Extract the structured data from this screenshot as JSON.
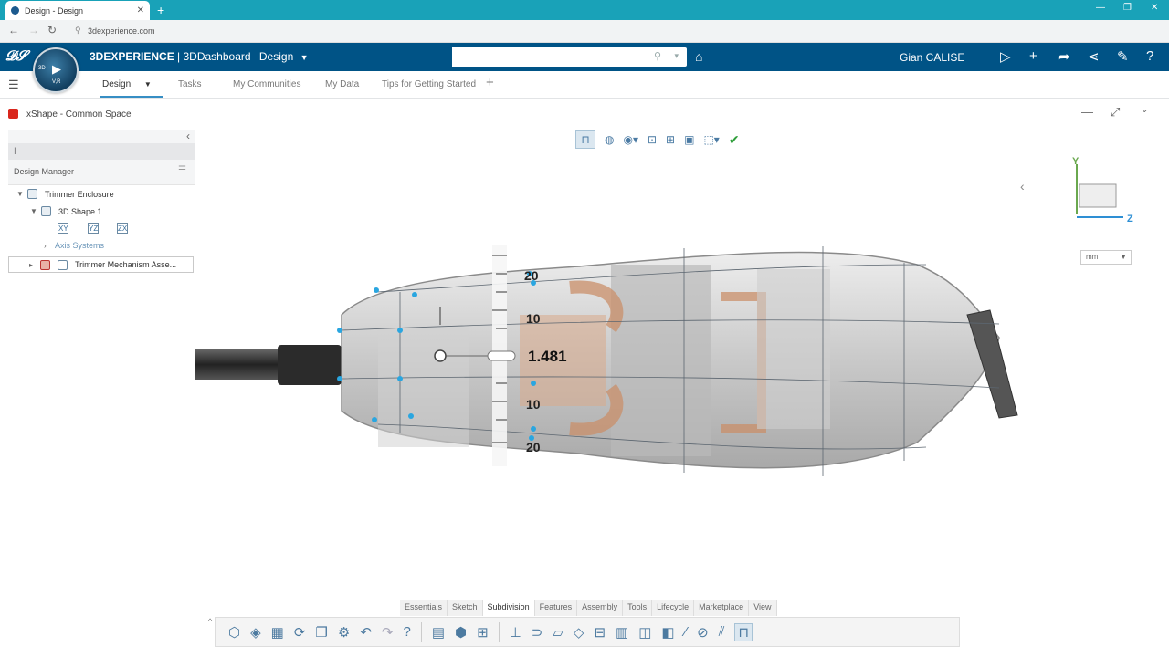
{
  "browser": {
    "tab_title": "Design - Design",
    "url": "3dexperience.com"
  },
  "header": {
    "brand_bold": "3DEXPERIENCE",
    "brand_rest": " | 3DDashboard",
    "dashboard_name": "Design",
    "search_placeholder": "",
    "user_name": "Gian CALISE",
    "compass_top": "3D",
    "compass_bottom": "V,R"
  },
  "dashboard_tabs": [
    "Design",
    "Tasks",
    "My Communities",
    "My Data",
    "Tips for Getting Started"
  ],
  "widget": {
    "title": "xShape - Common Space"
  },
  "design_manager": {
    "label": "Design Manager",
    "tree": {
      "root": "Trimmer Enclosure",
      "child": "3D Shape 1",
      "axis_planes": [
        "XY",
        "YZ",
        "ZX"
      ],
      "axis_systems": "Axis Systems",
      "assembly": "Trimmer Mechanism Asse..."
    }
  },
  "viewport": {
    "ruler_value": "1.481",
    "ruler_ticks": [
      "20",
      "10",
      "10",
      "20"
    ],
    "unit": "mm",
    "axes": {
      "y": "Y",
      "z": "Z"
    }
  },
  "section_tabs": [
    "Essentials",
    "Sketch",
    "Subdivision",
    "Features",
    "Assembly",
    "Tools",
    "Lifecycle",
    "Marketplace",
    "View"
  ],
  "active_section": "Subdivision"
}
